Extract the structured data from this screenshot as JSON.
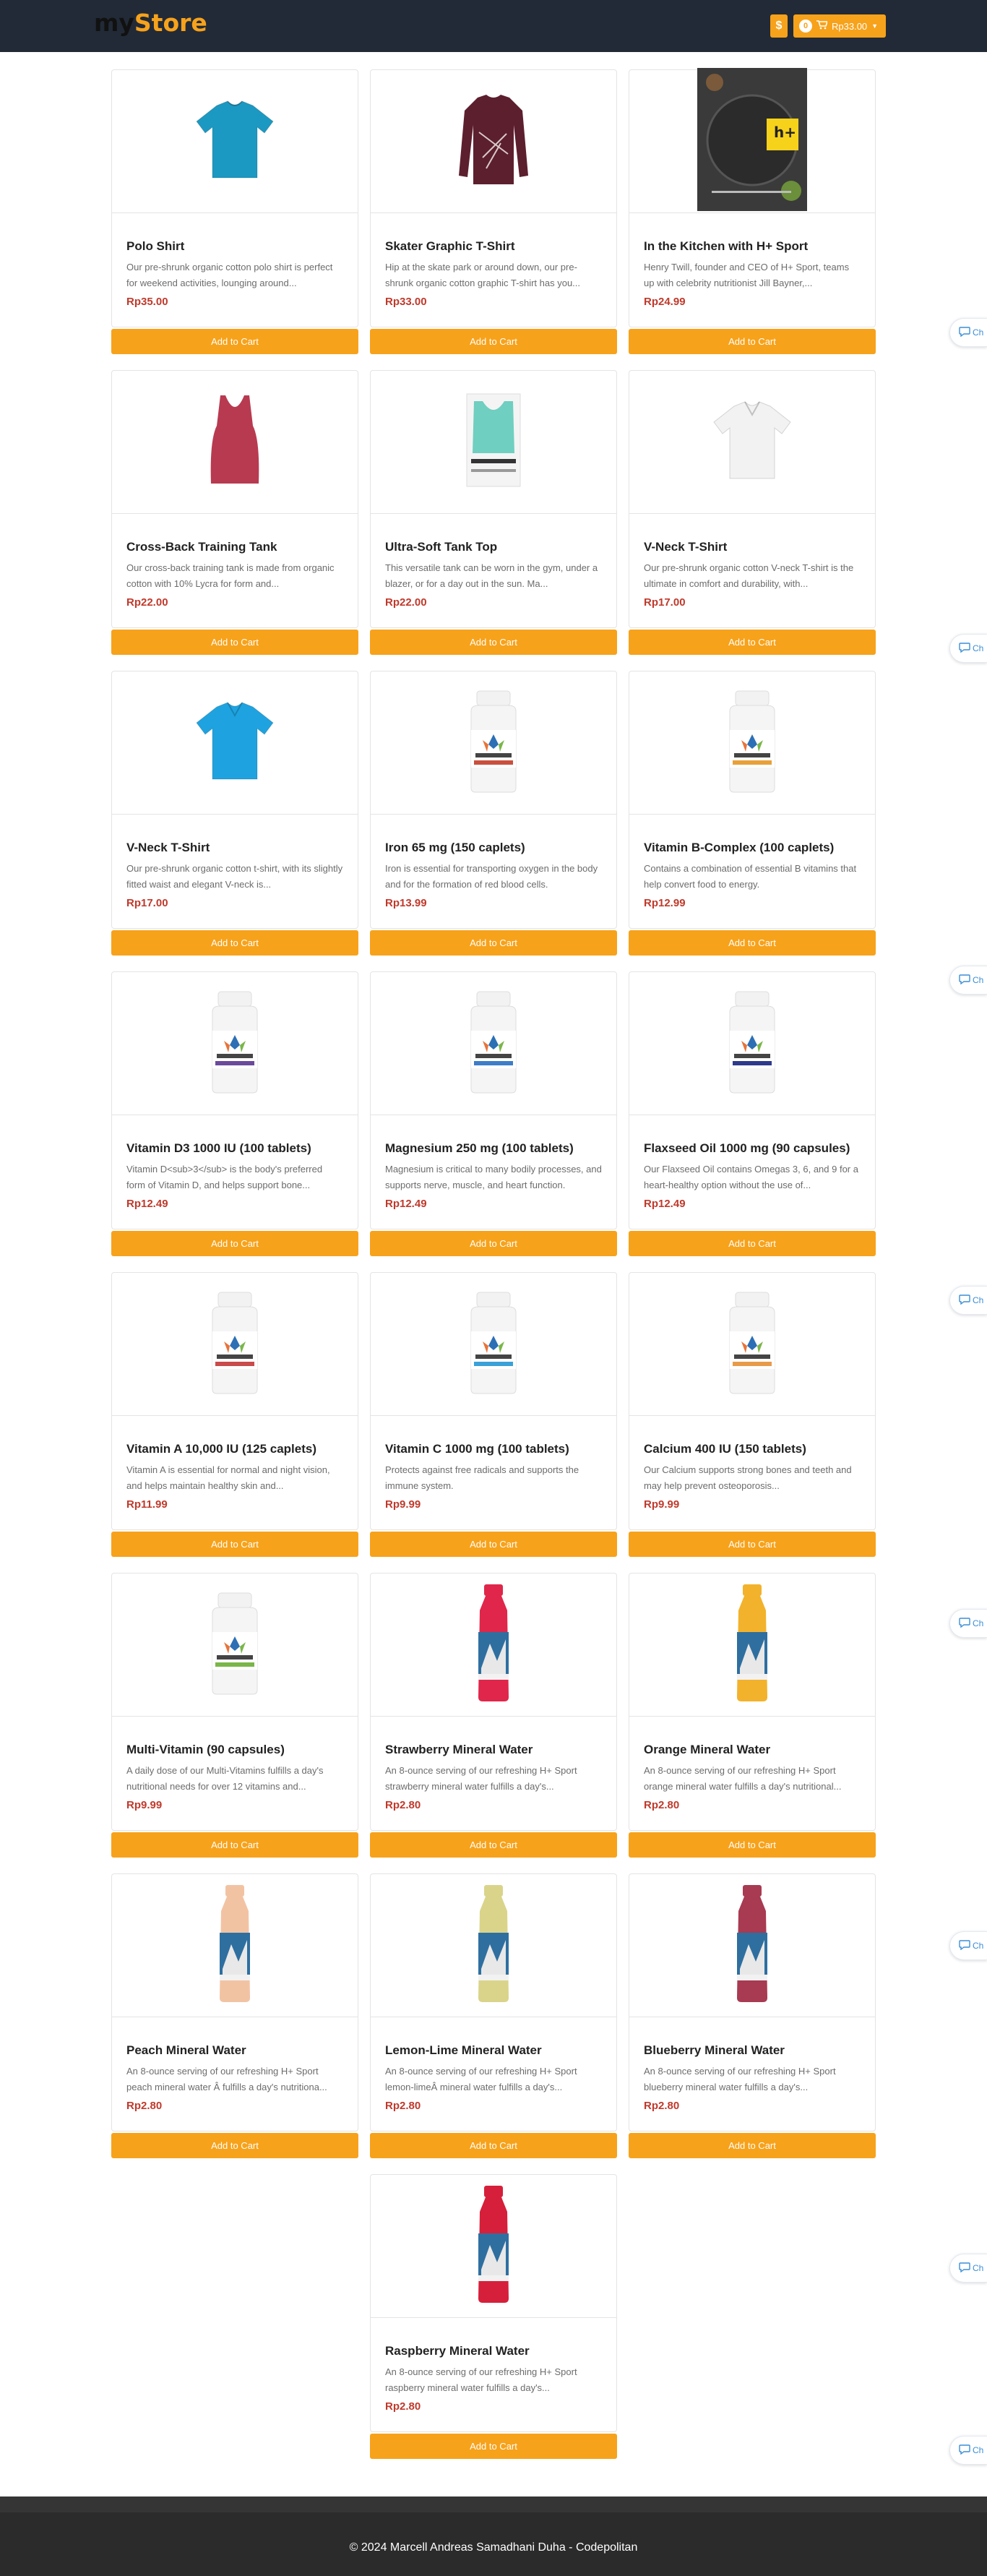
{
  "brand": {
    "part1": "my",
    "part2": "Store"
  },
  "header": {
    "currency_symbol": "$",
    "cart_count": "0",
    "cart_total": "Rp33.00"
  },
  "products": [
    {
      "name": "Polo Shirt",
      "description": "Our pre-shrunk organic cotton polo shirt is perfect for weekend activities, lounging around...",
      "price": "Rp35.00",
      "image": "polo-shirt-image",
      "color": "#1b99c2"
    },
    {
      "name": "Skater Graphic T-Shirt",
      "description": "Hip at the skate park or around down, our pre-shrunk organic cotton graphic T-shirt has you...",
      "price": "Rp33.00",
      "image": "long-sleeve-shirt-image",
      "color": "#5c1f2e"
    },
    {
      "name": "In the Kitchen with H+ Sport",
      "description": "Henry Twill, founder and CEO of H+ Sport, teams up with celebrity nutritionist Jill Bayner,...",
      "price": "Rp24.99",
      "image": "cookbook-cover-image",
      "color": "#3a3a3a"
    },
    {
      "name": "Cross-Back Training Tank",
      "description": "Our cross-back training tank is made from organic cotton with 10% Lycra for form and...",
      "price": "Rp22.00",
      "image": "tank-top-image",
      "color": "#b83a50"
    },
    {
      "name": "Ultra-Soft Tank Top",
      "description": "This versatile tank can be worn in the gym, under a blazer, or for a day out in the sun. Ma...",
      "price": "Rp22.00",
      "image": "folded-tank-image",
      "color": "#6fcfc0"
    },
    {
      "name": "V-Neck T-Shirt",
      "description": "Our pre-shrunk organic cotton V-neck T-shirt is the ultimate in comfort and durability, with...",
      "price": "Rp17.00",
      "image": "tshirt-white-image",
      "color": "#f2f2f2"
    },
    {
      "name": "V-Neck T-Shirt",
      "description": "Our pre-shrunk organic cotton t-shirt, with its slightly fitted waist and elegant V-neck is...",
      "price": "Rp17.00",
      "image": "tshirt-blue-image",
      "color": "#1ea3e0"
    },
    {
      "name": "Iron 65 mg (150 caplets)",
      "description": "Iron is essential for transporting oxygen in the body and for the formation of red blood cells.",
      "price": "Rp13.99",
      "image": "supplement-bottle-image",
      "color": "#c9503d"
    },
    {
      "name": "Vitamin B-Complex (100 caplets)",
      "description": "Contains a combination of essential B vitamins that help convert food to energy.",
      "price": "Rp12.99",
      "image": "supplement-bottle-image",
      "color": "#e8a13a"
    },
    {
      "name": "Vitamin D3 1000 IU (100 tablets)",
      "description": "Vitamin D<sub>3</sub> is the body's preferred form of Vitamin D, and helps support bone...",
      "price": "Rp12.49",
      "image": "supplement-bottle-image",
      "color": "#6a4a9c"
    },
    {
      "name": "Magnesium 250 mg (100 tablets)",
      "description": "Magnesium is critical to many bodily processes, and supports nerve, muscle, and heart function.",
      "price": "Rp12.49",
      "image": "supplement-bottle-image",
      "color": "#3d7cc9"
    },
    {
      "name": "Flaxseed Oil 1000 mg (90 capsules)",
      "description": "Our Flaxseed Oil contains Omegas 3, 6, and 9 for a heart-healthy option without the use of...",
      "price": "Rp12.49",
      "image": "supplement-bottle-image",
      "color": "#2e3a8c"
    },
    {
      "name": "Vitamin A 10,000 IU (125 caplets)",
      "description": "Vitamin A is essential for normal and night vision, and helps maintain healthy skin and...",
      "price": "Rp11.99",
      "image": "supplement-bottle-image",
      "color": "#c94b4b"
    },
    {
      "name": "Vitamin C 1000 mg (100 tablets)",
      "description": "Protects against free radicals and supports the immune system.",
      "price": "Rp9.99",
      "image": "supplement-bottle-image",
      "color": "#3aa0d8"
    },
    {
      "name": "Calcium 400 IU (150 tablets)",
      "description": "Our Calcium supports strong bones and teeth and may help prevent osteoporosis...",
      "price": "Rp9.99",
      "image": "supplement-bottle-image",
      "color": "#e89a4a"
    },
    {
      "name": "Multi-Vitamin (90 capsules)",
      "description": "A daily dose of our Multi-Vitamins fulfills a day's nutritional needs for over 12 vitamins and...",
      "price": "Rp9.99",
      "image": "supplement-bottle-image",
      "color": "#7ab648"
    },
    {
      "name": "Strawberry Mineral Water",
      "description": "An 8-ounce serving of our refreshing H+ Sport strawberry mineral water fulfills a day's...",
      "price": "Rp2.80",
      "image": "water-bottle-image",
      "color": "#e0264a"
    },
    {
      "name": "Orange Mineral Water",
      "description": "An 8-ounce serving of our refreshing H+ Sport orange mineral water fulfills a day's nutritional...",
      "price": "Rp2.80",
      "image": "water-bottle-image",
      "color": "#f3b22b"
    },
    {
      "name": "Peach Mineral Water",
      "description": "An 8-ounce serving of our refreshing H+ Sport peach mineral water Â fulfills a day's nutritiona...",
      "price": "Rp2.80",
      "image": "water-bottle-image",
      "color": "#f2c3a3"
    },
    {
      "name": "Lemon-Lime Mineral Water",
      "description": "An 8-ounce serving of our refreshing H+ Sport lemon-limeÂ mineral water fulfills a day's...",
      "price": "Rp2.80",
      "image": "water-bottle-image",
      "color": "#d9d48a"
    },
    {
      "name": "Blueberry Mineral Water",
      "description": "An 8-ounce serving of our refreshing H+ Sport blueberry mineral water fulfills a day's...",
      "price": "Rp2.80",
      "image": "water-bottle-image",
      "color": "#a83a52"
    },
    {
      "name": "Raspberry Mineral Water",
      "description": "An 8-ounce serving of our refreshing H+ Sport raspberry mineral water fulfills a day's...",
      "price": "Rp2.80",
      "image": "water-bottle-image",
      "color": "#d61f3a"
    }
  ],
  "add_to_cart_label": "Add to Cart",
  "chat_tab_label": "Ch",
  "footer": {
    "text": "© 2024 Marcell Andreas Samadhani Duha - Codepolitan"
  },
  "colors": {
    "accent": "#f7a21b",
    "navbar": "#222a37",
    "price": "#c0392b",
    "footer": "#2b2b2b"
  }
}
